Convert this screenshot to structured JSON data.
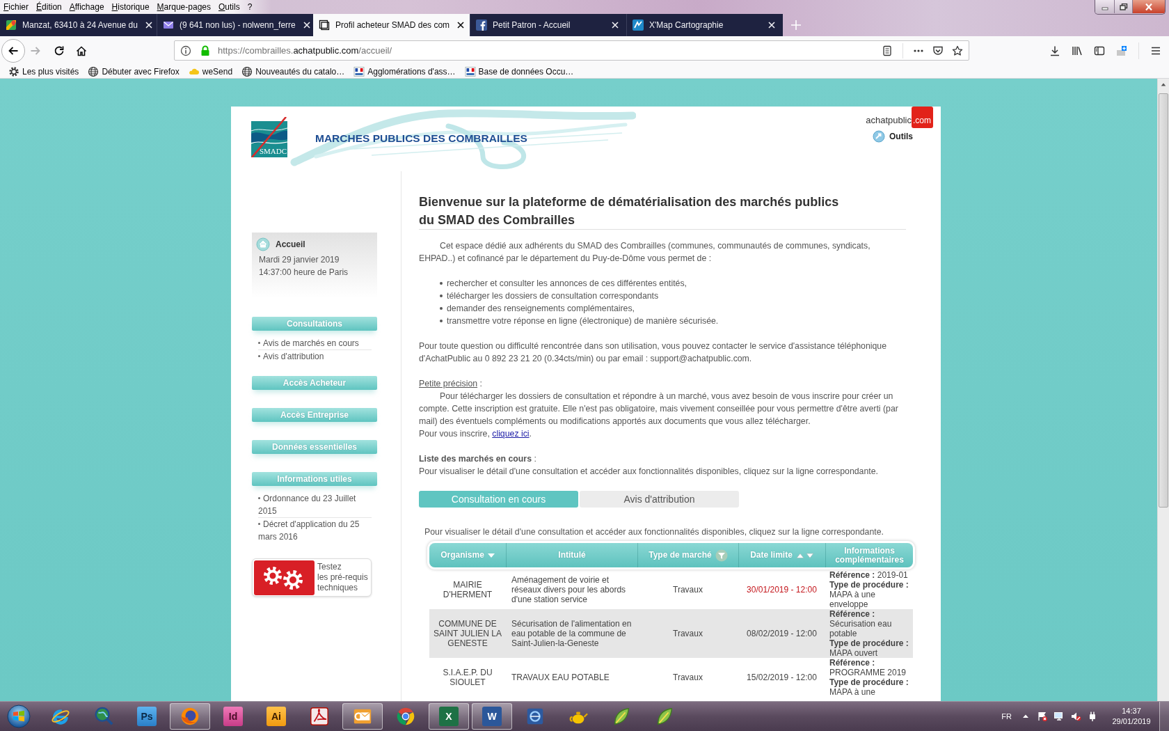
{
  "menu_bar": [
    "Fichier",
    "Édition",
    "Affichage",
    "Historique",
    "Marque-pages",
    "Outils",
    "?"
  ],
  "tabs": [
    {
      "title": "Manzat, 63410 à 24 Avenue du",
      "kind": "map",
      "selected": false
    },
    {
      "title": "(9 641 non lus) - nolwenn_ferre",
      "kind": "mail",
      "selected": false
    },
    {
      "title": "Profil acheteur SMAD des com",
      "kind": "page",
      "selected": true
    },
    {
      "title": "Petit Patron - Accueil",
      "kind": "social",
      "selected": false
    },
    {
      "title": "X'Map Cartographie",
      "kind": "map_tile",
      "selected": false
    }
  ],
  "nav_buttons": [
    {
      "kind": "back",
      "disabled": false
    },
    {
      "kind": "forward",
      "disabled": true
    },
    {
      "kind": "reload",
      "disabled": false
    },
    {
      "kind": "home",
      "disabled": false
    }
  ],
  "address_bar": {
    "url_start": "https://combrailles.",
    "url_domain": "achatpublic.com",
    "url_end": "/accueil/"
  },
  "bookmarks": [
    {
      "label": "Les plus visités",
      "kind": "gear"
    },
    {
      "label": "Débuter avec Firefox",
      "kind": "globe"
    },
    {
      "label": "weSend",
      "kind": "cloud"
    },
    {
      "label": "Nouveautés du catalo…",
      "kind": "globe"
    },
    {
      "label": "Agglomérations d'ass…",
      "kind": "flag"
    },
    {
      "label": "Base de données Occu…",
      "kind": "flag"
    }
  ],
  "page": {
    "header": {
      "logo_text": "SMADC",
      "banner_title": "MARCHES PUBLICS DES COMBRAILLES",
      "brand_name": "achatpublic",
      "brand_suffix": ".com",
      "tools_link": "Outils"
    },
    "home_box": {
      "title": "Accueil",
      "date": "Mardi 29 janvier 2019",
      "time": "14:37:00 heure de Paris"
    },
    "sidebar": [
      {
        "title": "Consultations",
        "links": [
          "Avis de marchés en cours",
          "Avis d'attribution"
        ]
      },
      {
        "title": "Accès Acheteur"
      },
      {
        "title": "Accès Entreprise"
      },
      {
        "title": "Données essentielles"
      },
      {
        "title": "Informations utiles",
        "links": [
          "Ordonnance du 23 Juillet 2015",
          "Décret d'application du 25 mars 2016"
        ]
      }
    ],
    "prerequisites_button": {
      "lines": [
        "Testez",
        "les pré-requis",
        "techniques"
      ]
    },
    "welcome": {
      "title_lines": [
        "Bienvenue sur la plateforme de dématérialisation des marchés publics",
        "du SMAD des Combrailles"
      ],
      "intro": "Cet espace dédié aux adhérents du SMAD des Combrailles (communes, communautés de communes, syndicats, EHPAD..) et cofinancé par le département du Puy-de-Dôme vous permet de :",
      "bullets": [
        "rechercher et consulter les annonces de ces différentes entités,",
        "télécharger les dossiers de consultation correspondants",
        "demander des renseignements complémentaires,",
        "transmettre votre réponse en ligne (électronique) de manière sécurisée."
      ],
      "contact": "Pour toute question ou difficulté rencontrée dans son utilisation, vous pouvez contacter le service d'assistance téléphonique d'AchatPublic au 0 892 23 21 20 (0.34cts/min) ou par email : support@achatpublic.com.",
      "note_label": "Petite précision",
      "note_label_suffix": ":",
      "note": "Pour télécharger les dossiers de consultation et répondre à un marché, vous avez besoin de vous inscrire pour créer un compte. Cette inscription est gratuite. Elle n'est pas obligatoire, mais vivement conseillée pour vous permettre d'être averti (par mail) des éventuels compléments ou modifications apportés aux documents que vous allez télécharger.",
      "signup_prefix": "Pour vous inscrire,",
      "signup_link": "cliquez ici",
      "signup_suffix": ".",
      "list_heading": "**Liste des marchés en cours** :",
      "list_hint": "Pour visualiser le détail d'une consultation et accéder aux fonctionnalités disponibles, cliquez sur la ligne correspondante."
    },
    "list_tabs": [
      {
        "label": "Consultation en cours",
        "selected": true
      },
      {
        "label": "Avis d'attribution",
        "selected": false
      }
    ],
    "table_hint": "Pour visualiser le détail d'une consultation et accéder aux fonctionnalités disponibles, cliquez sur la ligne correspondante.",
    "table": {
      "columns": [
        {
          "label": "Organisme",
          "kind": "sort_down"
        },
        {
          "label": "Intitulé",
          "kind": "plain"
        },
        {
          "label": "Type de marché",
          "kind": "filter"
        },
        {
          "label": "Date limite",
          "kind": "sort_both"
        },
        {
          "label": "Informations complémentaires",
          "kind": "plain"
        }
      ],
      "rows": [
        {
          "organisme": "MAIRIE D'HERMENT",
          "title": "Aménagement de voirie et réseaux divers pour les abords d'une station service",
          "type": "Travaux",
          "deadline": "30/01/2019 - 12:00",
          "deadline_near": true,
          "info": [
            "**Référence :** 2019-01",
            "**Type de procédure :** MAPA à une enveloppe"
          ]
        },
        {
          "organisme": "COMMUNE DE SAINT JULIEN LA GENESTE",
          "title": "Sécurisation de l'alimentation en eau potable de la commune de Saint-Julien-la-Geneste",
          "type": "Travaux",
          "deadline": "08/02/2019 - 12:00",
          "deadline_near": false,
          "info": [
            "**Référence :** Sécurisation eau potable",
            "**Type de procédure :** MAPA ouvert"
          ]
        },
        {
          "organisme": "S.I.A.E.P. DU SIOULET",
          "title": "TRAVAUX EAU POTABLE",
          "type": "Travaux",
          "deadline": "15/02/2019 - 12:00",
          "deadline_near": false,
          "info": [
            "**Référence :** PROGRAMME 2019",
            "**Type de procédure :** MAPA à une"
          ]
        }
      ]
    }
  },
  "taskbar": {
    "apps": [
      {
        "kind": "ie",
        "running": false
      },
      {
        "kind": "globe_search",
        "running": false
      },
      {
        "kind": "ps",
        "label": "Ps",
        "running": false
      },
      {
        "kind": "firefox",
        "running": true
      },
      {
        "kind": "id",
        "label": "Id",
        "running": false
      },
      {
        "kind": "ai",
        "label": "Ai",
        "running": false
      },
      {
        "kind": "acrobat",
        "running": false
      },
      {
        "kind": "outlook",
        "running": true
      },
      {
        "kind": "chrome",
        "running": false
      },
      {
        "kind": "excel",
        "label": "X",
        "running": true
      },
      {
        "kind": "word",
        "label": "W",
        "running": true
      },
      {
        "kind": "app",
        "running": false
      },
      {
        "kind": "teapot",
        "running": false
      },
      {
        "kind": "leaf",
        "running": false
      },
      {
        "kind": "leaf",
        "running": false
      }
    ],
    "language": "FR",
    "time": "14:37",
    "date": "29/01/2019"
  }
}
